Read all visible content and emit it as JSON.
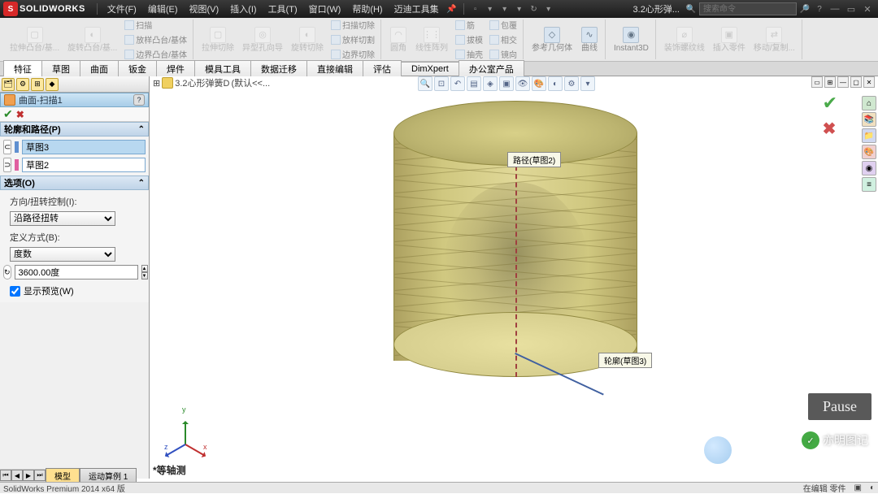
{
  "title": {
    "brand": "SOLIDWORKS",
    "menus": [
      "文件(F)",
      "编辑(E)",
      "视图(V)",
      "插入(I)",
      "工具(T)",
      "窗口(W)",
      "帮助(H)",
      "迈迪工具集"
    ],
    "doc": "3.2心形弹...",
    "search_placeholder": "搜索命令"
  },
  "ribbon": {
    "g1": [
      {
        "lbl": "拉伸凸台/基...",
        "ico": "▢"
      },
      {
        "lbl": "旋转凸台/基...",
        "ico": "◐"
      }
    ],
    "g1stack": [
      "扫描",
      "放样凸台/基体",
      "边界凸台/基体"
    ],
    "g2": [
      {
        "lbl": "拉伸切除",
        "ico": "▢"
      },
      {
        "lbl": "异型孔向导",
        "ico": "◎"
      },
      {
        "lbl": "旋转切除",
        "ico": "◐"
      }
    ],
    "g2stack": [
      "扫描切除",
      "放样切割",
      "边界切除"
    ],
    "g3": [
      {
        "lbl": "圆角",
        "ico": "◠"
      },
      {
        "lbl": "线性阵列",
        "ico": "⋮⋮"
      }
    ],
    "g3stack": [
      "筋",
      "拔模",
      "抽壳"
    ],
    "g3stack2": [
      "包覆",
      "相交",
      "镜向"
    ],
    "g4": [
      {
        "lbl": "参考几何体",
        "ico": "◇"
      },
      {
        "lbl": "曲线",
        "ico": "∿"
      }
    ],
    "g5": [
      {
        "lbl": "Instant3D",
        "ico": "◉"
      }
    ],
    "g6": [
      {
        "lbl": "装饰螺纹线",
        "ico": "⌀"
      },
      {
        "lbl": "插入零件",
        "ico": "▣"
      },
      {
        "lbl": "移动/复制...",
        "ico": "⇄"
      }
    ]
  },
  "featureTabs": [
    "特征",
    "草图",
    "曲面",
    "钣金",
    "焊件",
    "模具工具",
    "数据迁移",
    "直接编辑",
    "评估",
    "DimXpert",
    "办公室产品"
  ],
  "activeFeatureTab": 0,
  "propPanel": {
    "title": "曲面-扫描1",
    "sec1": {
      "title": "轮廓和路径(P)",
      "profile": "草图3",
      "path": "草图2",
      "profile_color": "#6090d0",
      "path_color": "#e060a0"
    },
    "sec2": {
      "title": "选项(O)",
      "twistLabel": "方向/扭转控制(I):",
      "twistValue": "沿路径扭转",
      "defLabel": "定义方式(B):",
      "defValue": "度数",
      "angleValue": "3600.00度",
      "previewLabel": "显示预览(W)"
    }
  },
  "breadcrumb": {
    "doc": "3.2心形弹簧D",
    "config": "(默认<<..."
  },
  "callouts": {
    "path": "路径(草图2)",
    "profile": "轮廓(草图3)"
  },
  "viewName": "*等轴测",
  "triadLabels": {
    "x": "x",
    "y": "y",
    "z": "z"
  },
  "bottomTabs": [
    "模型",
    "运动算例 1"
  ],
  "status": {
    "left": "SolidWorks Premium 2014 x64 版",
    "right1": "在编辑 零件"
  },
  "pause": "Pause",
  "watermark": "亦明图记"
}
